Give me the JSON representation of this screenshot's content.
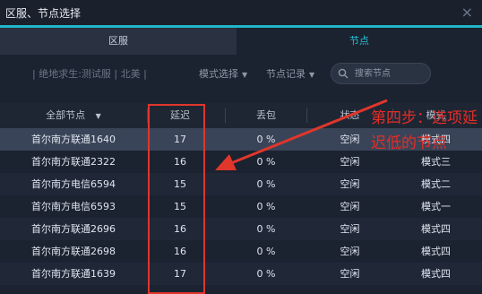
{
  "window": {
    "title": "区服、节点选择",
    "close_glyph": "×"
  },
  "tabs": [
    {
      "label": "区服"
    },
    {
      "label": "节点"
    }
  ],
  "filters": {
    "breadcrumb": "| 绝地求生:测试服 | 北美 |",
    "mode_select": "模式选择",
    "node_record": "节点记录",
    "search_placeholder": "搜索节点"
  },
  "table": {
    "headers": {
      "node": "全部节点",
      "latency": "延迟",
      "loss": "丢包",
      "status": "状态",
      "mode": "模式"
    },
    "rows": [
      {
        "name": "首尔南方联通1640",
        "latency": "17",
        "loss": "0 %",
        "status": "空闲",
        "mode": "模式四"
      },
      {
        "name": "首尔南方联通2322",
        "latency": "16",
        "loss": "0 %",
        "status": "空闲",
        "mode": "模式三"
      },
      {
        "name": "首尔南方电信6594",
        "latency": "15",
        "loss": "0 %",
        "status": "空闲",
        "mode": "模式二"
      },
      {
        "name": "首尔南方电信6593",
        "latency": "15",
        "loss": "0 %",
        "status": "空闲",
        "mode": "模式一"
      },
      {
        "name": "首尔南方联通2696",
        "latency": "16",
        "loss": "0 %",
        "status": "空闲",
        "mode": "模式四"
      },
      {
        "name": "首尔南方联通2698",
        "latency": "16",
        "loss": "0 %",
        "status": "空闲",
        "mode": "模式四"
      },
      {
        "name": "首尔南方联通1639",
        "latency": "17",
        "loss": "0 %",
        "status": "空闲",
        "mode": "模式四"
      }
    ]
  },
  "annotation": {
    "text": "第四步：选项延迟低的节点",
    "color": "#e52d27"
  },
  "colors": {
    "accent": "#1fb6c9",
    "selected_row": "#3a4458",
    "highlight_box": "#e0362b"
  }
}
